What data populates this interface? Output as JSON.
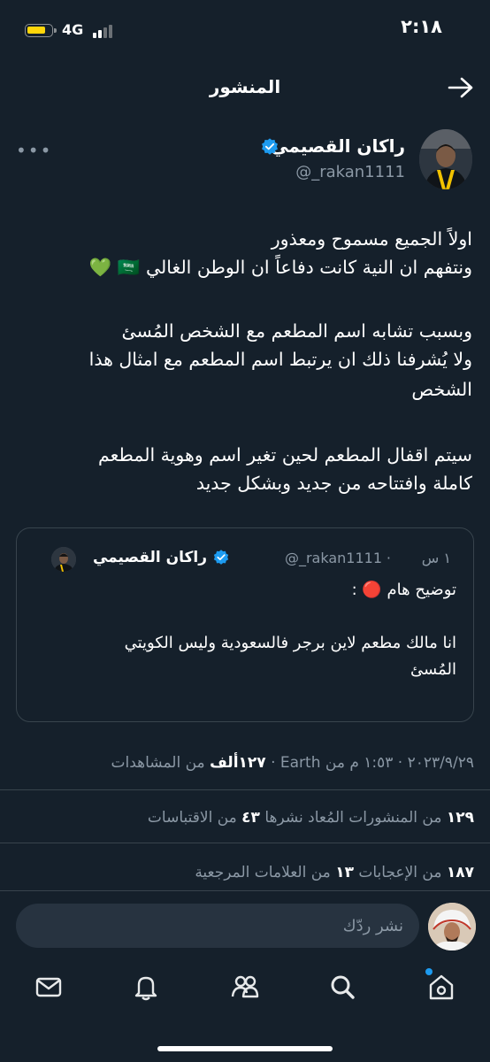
{
  "status_bar": {
    "time": "٢:١٨",
    "network": "4G"
  },
  "header": {
    "title": "المنشور"
  },
  "post": {
    "author_name": "راكان القصيمي",
    "handle": "@_rakan1111",
    "body_lines": [
      "اولاً الجميع مسموح ومعذور",
      "ونتفهم ان النية كانت دفاعاً ان الوطن الغالي 🇸🇦 💚",
      "وبسبب تشابه اسم المطعم مع الشخص المُسئ",
      "ولا يُشرفنا ذلك ان يرتبط اسم المطعم مع امثال هذا",
      "الشخص",
      "سيتم اقفال المطعم لحين تغير اسم وهوية المطعم",
      "كاملة وافتتاحه من جديد وبشكل جديد"
    ],
    "quoted": {
      "author_name": "راكان القصيمي",
      "handle": "@_rakan1111",
      "time": "١ س",
      "lines": [
        "توضيح هام 🔴 :",
        "انا مالك مطعم لاين برجر فالسعودية وليس الكويتي",
        "المُسئ"
      ]
    },
    "meta": {
      "date": "٢٠٢٣/٩/٢٩",
      "time": "١:٥٣ م",
      "source": "من Earth",
      "views_count": "١٢٧ألف",
      "views_label": "من المشاهدات"
    },
    "stats": {
      "reposts_count": "١٢٩",
      "reposts_label": "من المنشورات المُعاد نشرها",
      "quotes_count": "٤٣",
      "quotes_label": "من الاقتباسات",
      "likes_count": "١٨٧",
      "likes_label": "من الإعجابات",
      "bookmarks_count": "١٣",
      "bookmarks_label": "من العلامات المرجعية"
    }
  },
  "reply": {
    "placeholder": "نشر ردّك"
  },
  "nav": {
    "items": [
      "home-icon",
      "search-icon",
      "people-icon",
      "bell-icon",
      "mail-icon"
    ]
  },
  "colors": {
    "background": "#15202b",
    "accent": "#1d9bf0",
    "secondary_text": "#8b98a5",
    "border": "#38444d"
  }
}
